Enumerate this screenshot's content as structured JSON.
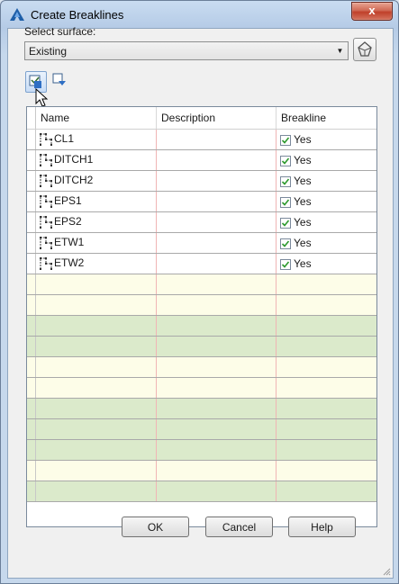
{
  "window": {
    "title": "Create Breaklines",
    "close_glyph": "x"
  },
  "surface": {
    "label": "Select surface:",
    "value": "Existing"
  },
  "grid": {
    "columns": [
      "Name",
      "Description",
      "Breakline"
    ],
    "rows": [
      {
        "name": "CL1",
        "description": "",
        "breakline": "Yes"
      },
      {
        "name": "DITCH1",
        "description": "",
        "breakline": "Yes"
      },
      {
        "name": "DITCH2",
        "description": "",
        "breakline": "Yes"
      },
      {
        "name": "EPS1",
        "description": "",
        "breakline": "Yes"
      },
      {
        "name": "EPS2",
        "description": "",
        "breakline": "Yes"
      },
      {
        "name": "ETW1",
        "description": "",
        "breakline": "Yes"
      },
      {
        "name": "ETW2",
        "description": "",
        "breakline": "Yes"
      }
    ]
  },
  "buttons": {
    "ok": "OK",
    "cancel": "Cancel",
    "help": "Help"
  },
  "colors": {
    "check_mark": "#2e9a2e",
    "close_button": "#c9452f",
    "empty_row_yellow": "#fdfde8",
    "empty_row_green": "#dbeacb"
  }
}
